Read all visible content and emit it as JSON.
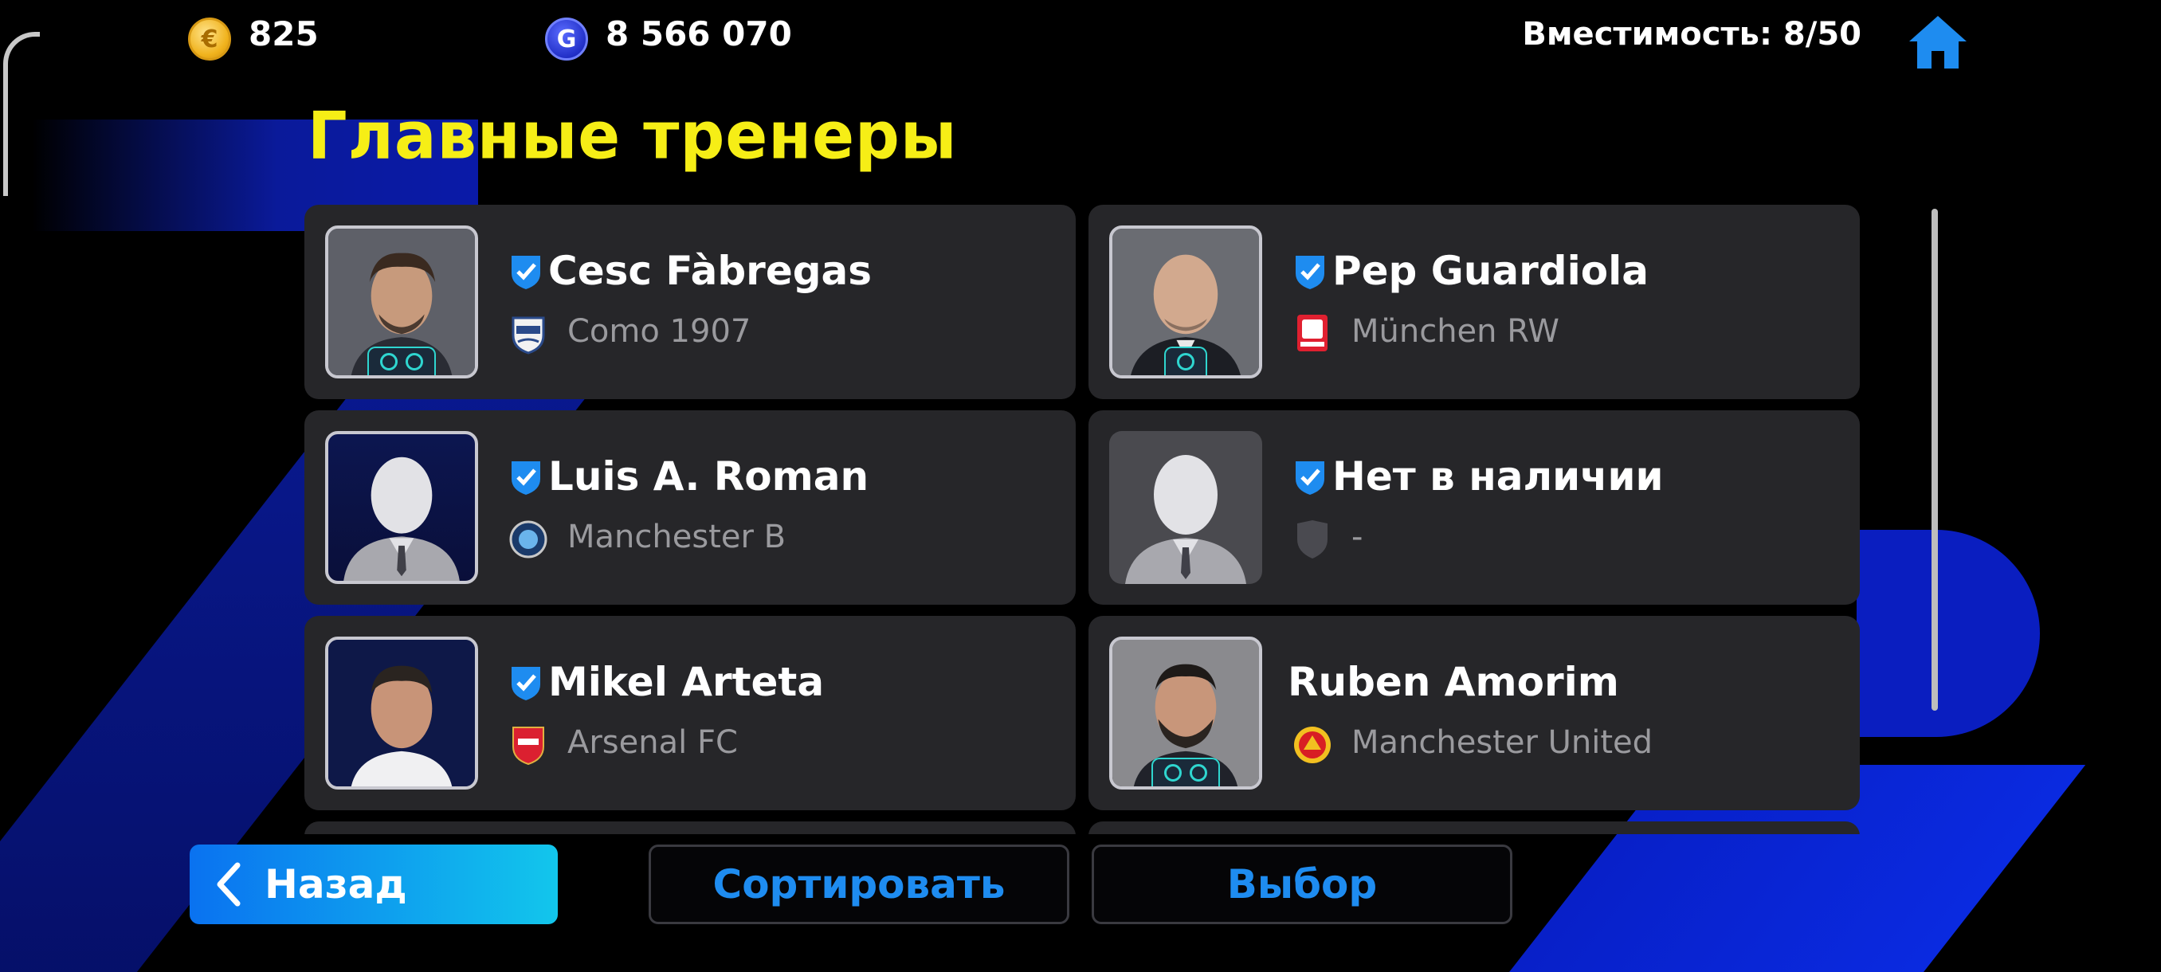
{
  "header": {
    "ecoin_amount": "825",
    "gp_amount": "8 566 070",
    "ecoin_symbol": "€",
    "gp_symbol": "G",
    "capacity_label": "Вместимость: 8/50"
  },
  "title": "Главные тренеры",
  "coaches": [
    {
      "name": "Cesc Fàbregas",
      "club": "Como 1907",
      "verified": true
    },
    {
      "name": "Pep Guardiola",
      "club": "München RW",
      "verified": true
    },
    {
      "name": "Luis A. Roman",
      "club": "Manchester B",
      "verified": true
    },
    {
      "name": "Нет в наличии",
      "club": "-",
      "verified": true
    },
    {
      "name": "Mikel Arteta",
      "club": "Arsenal FC",
      "verified": true
    },
    {
      "name": "Ruben Amorim",
      "club": "Manchester United",
      "verified": false
    }
  ],
  "footer": {
    "back_label": "Назад",
    "sort_label": "Сортировать",
    "select_label": "Выбор"
  },
  "colors": {
    "title": "#f6ee16",
    "accent_blue": "#1e8cf0",
    "card_bg": "#262629",
    "verify_badge": "#1e8cf0"
  }
}
